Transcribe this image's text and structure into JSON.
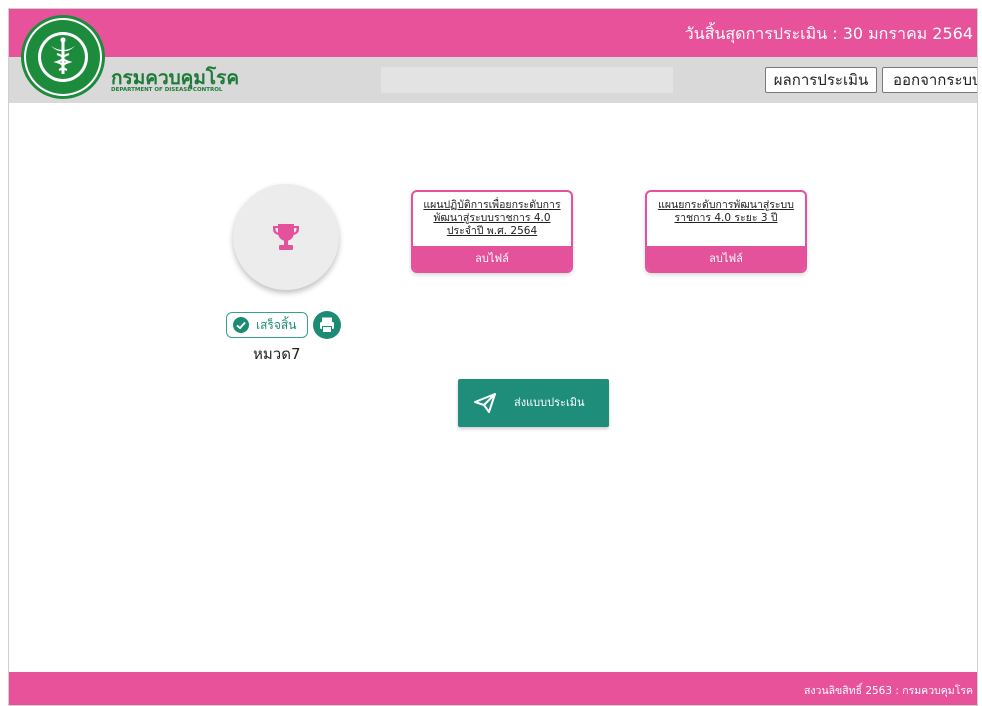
{
  "header": {
    "deadline_text": "วันสิ้นสุดการประเมิน : 30 มกราคม 2564",
    "department_name_th": "กรมควบคุมโรค",
    "department_name_en": "DEPARTMENT OF DISEASE CONTROL",
    "logo_ring_text": "MINISTRY OF PUBLIC HEALTH",
    "results_button": "ผลการประเมิน",
    "logout_button": "ออกจากระบบ"
  },
  "category": {
    "icon": "trophy-icon",
    "status_label": "เสร็จสิ้น",
    "status_icon": "check-circle-icon",
    "print_icon": "print-icon",
    "name": "หมวด7"
  },
  "documents": [
    {
      "title": "แผนปฏิบัติการเพื่อยกระดับการพัฒนาสู่ระบบราชการ 4.0 ประจำปี พ.ศ. 2564",
      "delete_label": "ลบไฟล์"
    },
    {
      "title": "แผนยกระดับการพัฒนาสู่ระบบราชการ 4.0 ระยะ 3 ปี",
      "delete_label": "ลบไฟล์"
    }
  ],
  "submit": {
    "label": "ส่งแบบประเมิน",
    "icon": "paper-plane-icon"
  },
  "footer": {
    "copyright": "สงวนลิขสิทธิ์ 2563 : กรมควบคุมโรค"
  },
  "colors": {
    "pink": "#e8529a",
    "teal": "#1e8d7a",
    "green": "#1d7a38",
    "gray": "#d9d9d9"
  }
}
